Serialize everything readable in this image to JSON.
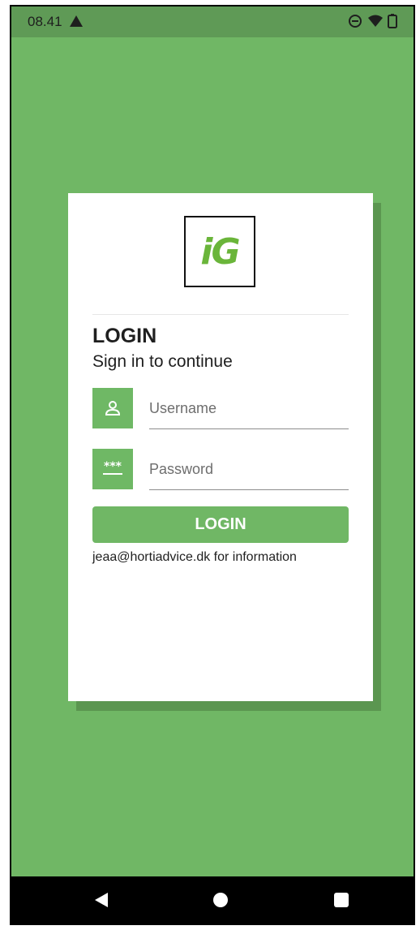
{
  "status_bar": {
    "time": "08.41",
    "icons": [
      "warning-icon",
      "do-not-disturb-icon",
      "wifi-icon",
      "battery-icon"
    ]
  },
  "card": {
    "logo_text": "iG",
    "title": "LOGIN",
    "subtitle": "Sign in to continue",
    "username": {
      "placeholder": "Username",
      "value": "",
      "icon": "user-icon"
    },
    "password": {
      "placeholder": "Password",
      "value": "",
      "icon": "password-icon"
    },
    "login_button_label": "LOGIN",
    "info_text": "jeaa@hortiadvice.dk for information"
  },
  "nav_bar": {
    "icons": [
      "back-icon",
      "home-icon",
      "recents-icon"
    ]
  },
  "colors": {
    "background": "#70b765",
    "status_bar": "#5f9a56",
    "accent": "#70b765",
    "logo": "#6ab53a"
  }
}
